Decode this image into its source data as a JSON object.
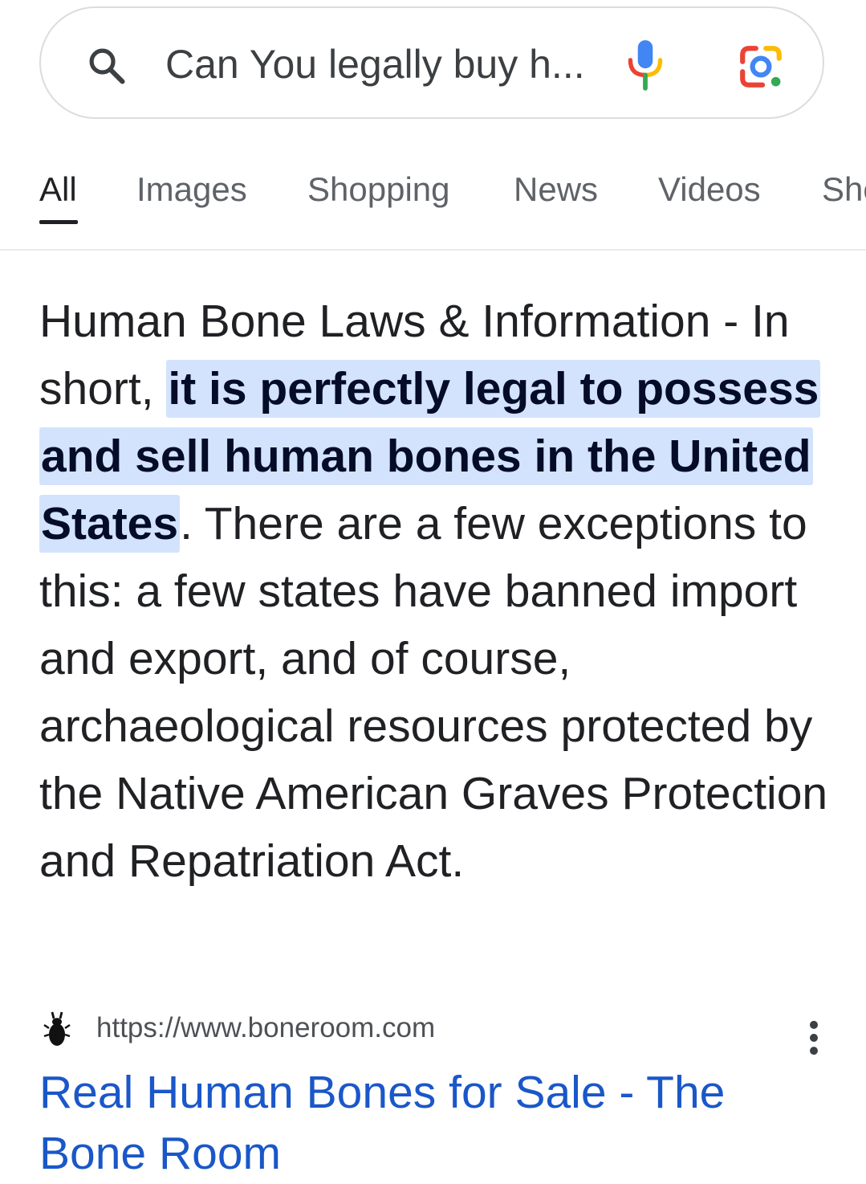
{
  "search": {
    "query": "Can You legally buy h...",
    "icons": {
      "search": "search-icon",
      "voice": "mic-icon",
      "lens": "lens-icon"
    }
  },
  "tabs": [
    {
      "label": "All",
      "active": true
    },
    {
      "label": "Images",
      "active": false
    },
    {
      "label": "Shopping",
      "active": false
    },
    {
      "label": "News",
      "active": false
    },
    {
      "label": "Videos",
      "active": false
    },
    {
      "label": "Sho",
      "active": false
    }
  ],
  "snippet": {
    "before": "Human Bone Laws & Information - In short, ",
    "highlight": "it is perfectly legal to possess and sell human bones in the United States",
    "after": ". There are a few exceptions to this: a few states have banned import and export, and of course, archaeological resources protected by the Native American Graves Protection and Repatriation Act."
  },
  "result": {
    "url": "https://www.boneroom.com",
    "title": "Real Human Bones for Sale - The Bone Room",
    "favicon": "beetle-favicon-icon",
    "menu_icon": "more-vert-icon"
  },
  "colors": {
    "link": "#1a57c8",
    "highlight_bg": "#d3e3fd",
    "text": "#202124",
    "muted": "#5f6368"
  }
}
